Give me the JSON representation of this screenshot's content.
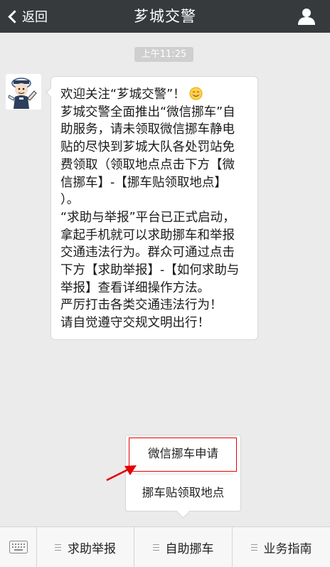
{
  "topbar": {
    "back_label": "返回",
    "title": "芗城交警",
    "profile_icon": "person-icon"
  },
  "timestamp": "上午11:25",
  "message": {
    "lines": [
      "欢迎关注“芗城交警”！",
      "芗城交警全面推出“微信挪车”自",
      "助服务，请未领取微信挪车静电",
      "贴的尽快到芗城大队各处罚站免",
      "费领取（领取地点点击下方【微",
      "信挪车】-【挪车贴领取地点】",
      "）。",
      "“求助与举报”平台已正式启动，",
      "拿起手机就可以求助挪车和举报",
      "交通违法行为。群众可通过点击",
      "下方【求助举报】-【如何求助与",
      "举报】查看详细操作方法。",
      "严厉打击各类交通违法行为！",
      "请自觉遵守交规文明出行！"
    ],
    "emoji": "smiley-icon"
  },
  "popup": {
    "items": [
      "微信挪车申请",
      "挪车贴领取地点"
    ]
  },
  "bottom_menu": {
    "keyboard_icon": "keyboard-icon",
    "items": [
      "求助举报",
      "自助挪车",
      "业务指南"
    ]
  },
  "colors": {
    "topbar": "#363a3d",
    "background": "#ebebeb",
    "highlight": "#e60000"
  }
}
